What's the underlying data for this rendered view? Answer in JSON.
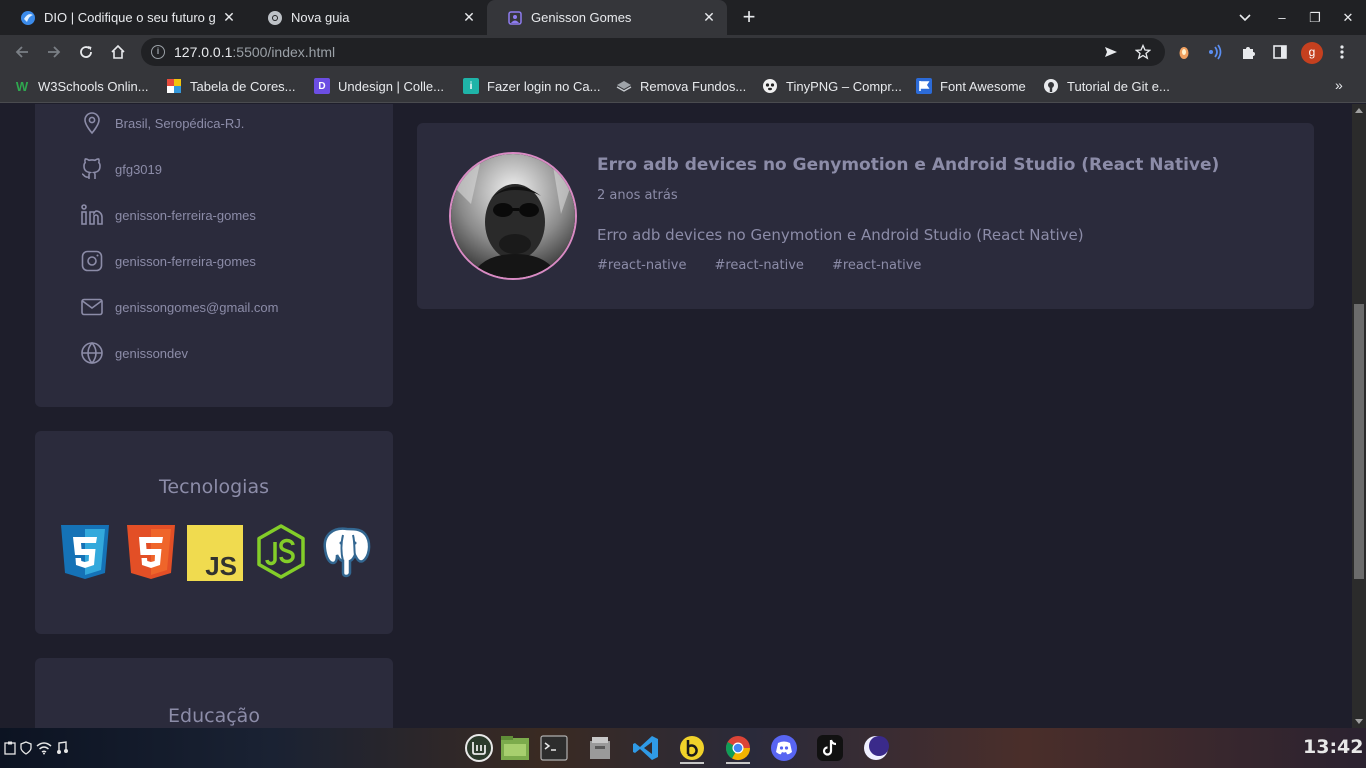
{
  "tabs": [
    {
      "title": "DIO | Codifique o seu futuro g",
      "icon": "dio-icon",
      "active": false
    },
    {
      "title": "Nova guia",
      "icon": "chrome-icon",
      "active": false
    },
    {
      "title": "Genisson Gomes",
      "icon": "page-icon",
      "active": true
    }
  ],
  "newtab_label": "+",
  "window_controls": {
    "minimize": "–",
    "maximize": "❐",
    "close": "✕"
  },
  "address_bar": {
    "host": "127.0.0.1",
    "path": ":5500/index.html"
  },
  "bookmarks": [
    {
      "label": "W3Schools Onlin...",
      "icon": "w3schools-icon"
    },
    {
      "label": "Tabela de Cores...",
      "icon": "color-table-icon"
    },
    {
      "label": "Undesign | Colle...",
      "icon": "undesign-icon"
    },
    {
      "label": "Fazer login no Ca...",
      "icon": "canva-icon"
    },
    {
      "label": "Remova Fundos...",
      "icon": "removebg-icon"
    },
    {
      "label": "TinyPNG – Compr...",
      "icon": "tinypng-icon"
    },
    {
      "label": "Font Awesome",
      "icon": "fontawesome-icon"
    },
    {
      "label": "Tutorial de Git e...",
      "icon": "github-icon"
    }
  ],
  "bookmarks_more": "»",
  "profile_initial": "g",
  "contacts": [
    {
      "icon": "location-icon",
      "text": "Brasil, Seropédica-RJ."
    },
    {
      "icon": "github-icon",
      "text": "gfg3019"
    },
    {
      "icon": "linkedin-icon",
      "text": "genisson-ferreira-gomes"
    },
    {
      "icon": "instagram-icon",
      "text": "genisson-ferreira-gomes"
    },
    {
      "icon": "mail-icon",
      "text": "genissongomes@gmail.com"
    },
    {
      "icon": "globe-icon",
      "text": "genissondev"
    }
  ],
  "technologies": {
    "title": "Tecnologias",
    "items": [
      "css3-icon",
      "html5-icon",
      "js-icon",
      "nodejs-icon",
      "postgresql-icon"
    ],
    "js_label": "JS"
  },
  "education": {
    "title": "Educação"
  },
  "post": {
    "title": "Erro adb devices no Genymotion e Android Studio (React Native)",
    "time": "2 anos atrás",
    "description": "Erro adb devices no Genymotion e Android Studio (React Native)",
    "tags": [
      "#react-native",
      "#react-native",
      "#react-native"
    ]
  },
  "taskbar": {
    "clock": "13:42",
    "apps": [
      "mint-menu-icon",
      "files-icon",
      "terminal-icon",
      "file-manager-icon",
      "vscode-icon",
      "bitwarden-icon",
      "chrome-icon",
      "discord-icon",
      "tiktok-icon",
      "moon-app-icon"
    ]
  }
}
